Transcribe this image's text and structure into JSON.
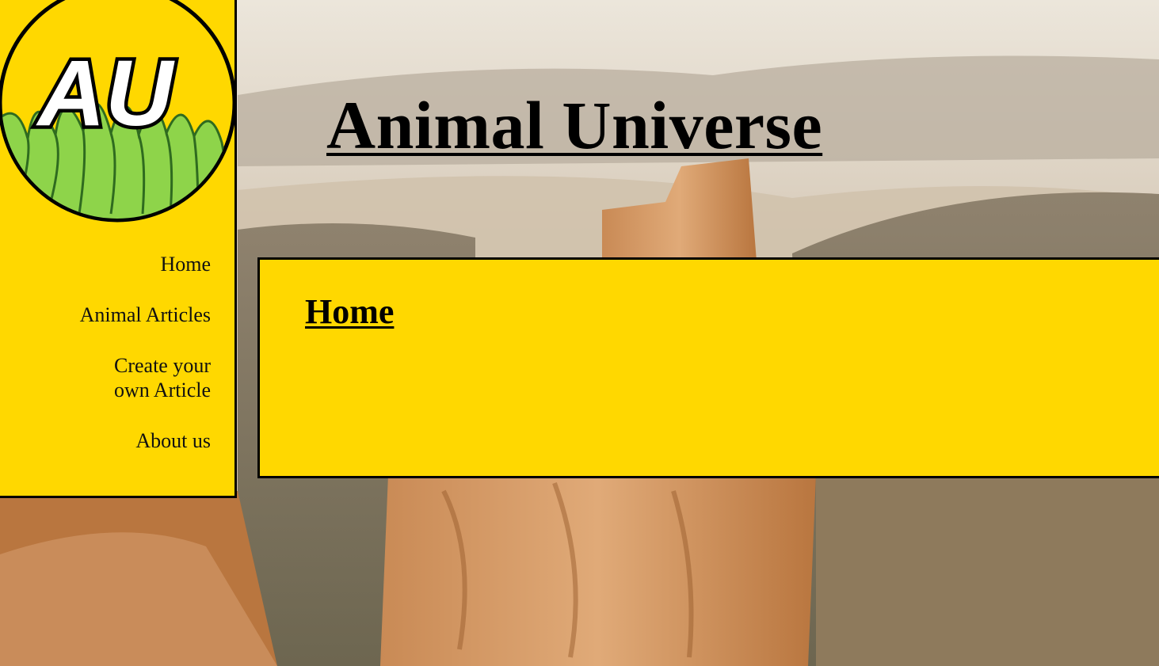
{
  "logo": {
    "text": "AU",
    "icon": "grass-logo-icon"
  },
  "header": {
    "title": "Animal Universe"
  },
  "nav": {
    "items": [
      {
        "label": "Home"
      },
      {
        "label": "Animal Articles"
      },
      {
        "label": "Create your own Article"
      },
      {
        "label": "About us"
      }
    ]
  },
  "main": {
    "heading": "Home"
  },
  "colors": {
    "accent": "#FFD800",
    "border": "#000000"
  }
}
